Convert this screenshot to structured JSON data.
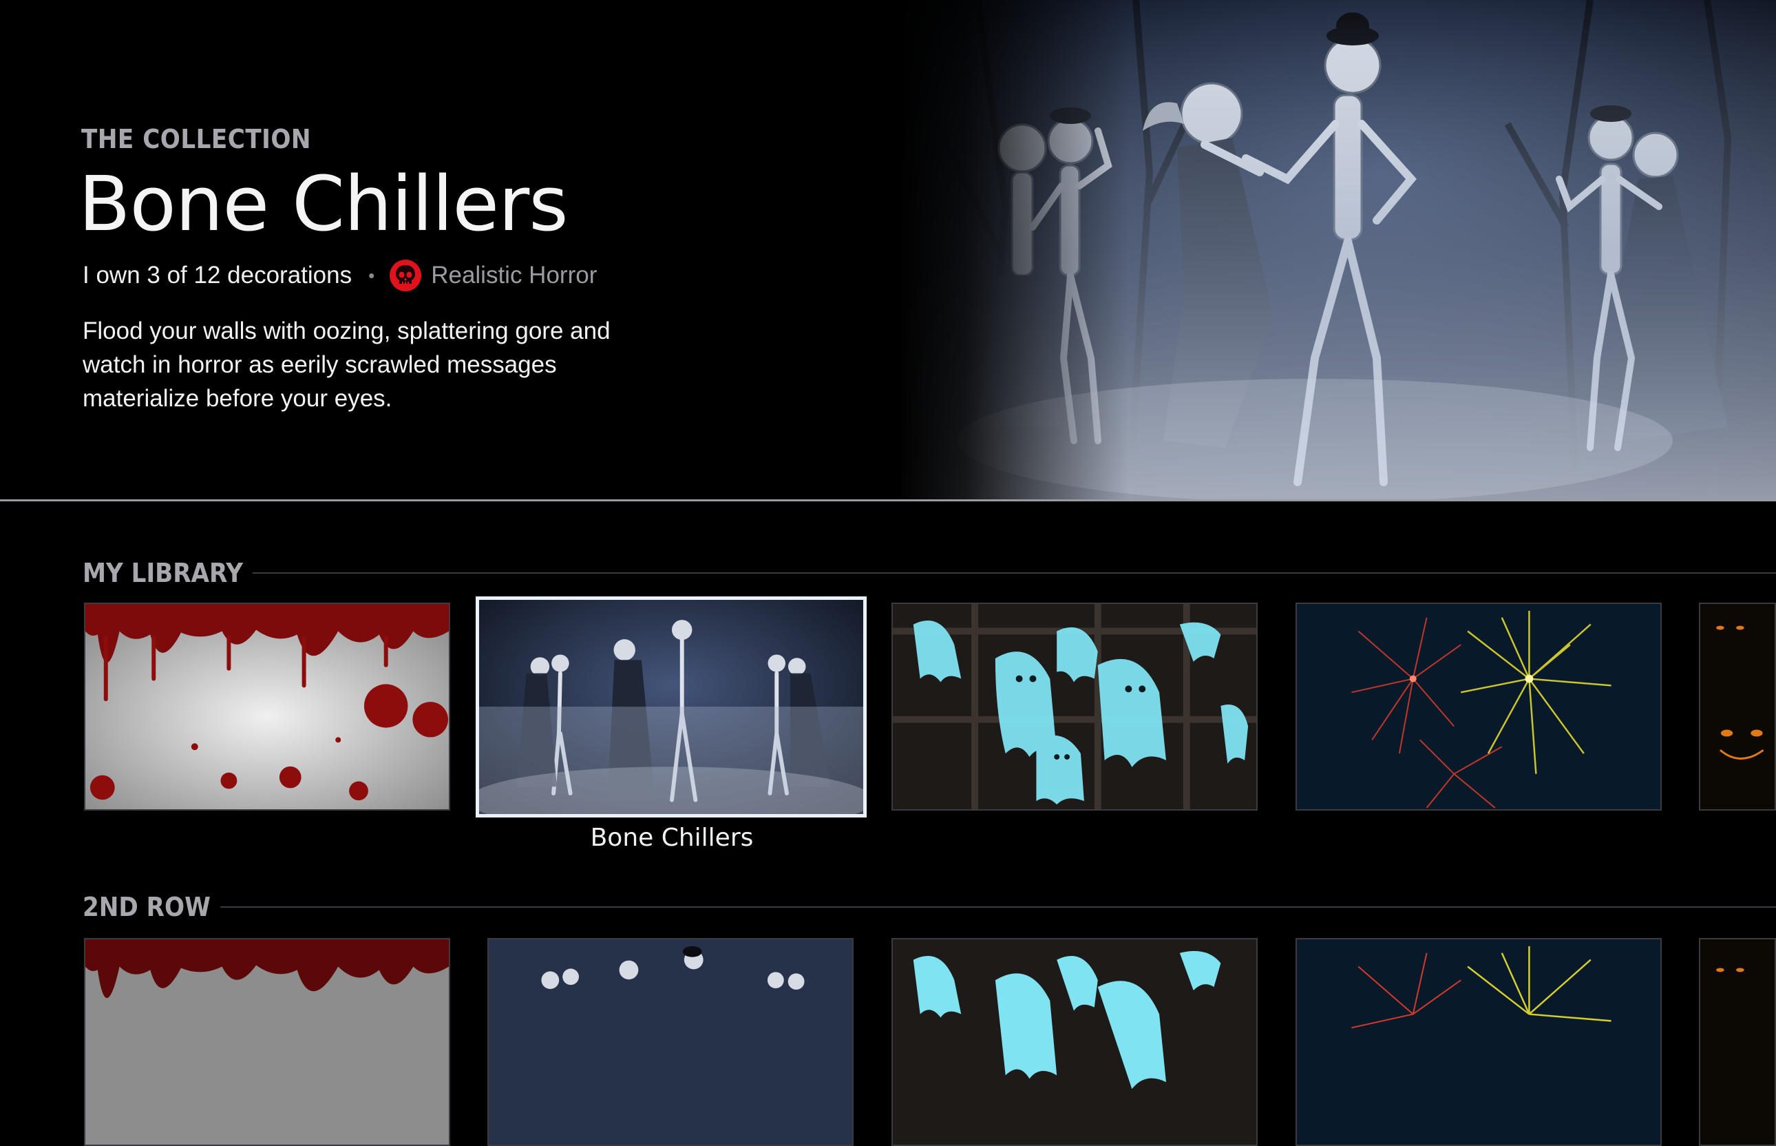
{
  "hero": {
    "eyebrow": "THE COLLECTION",
    "title": "Bone Chillers",
    "ownership": "I own 3 of 12 decorations",
    "separator": "•",
    "genre_icon": "red-skull-icon",
    "genre": "Realistic Horror",
    "description": "Flood your walls with oozing, splattering gore and watch in horror as eerily scrawled messages materialize before your eyes.",
    "art": "dancing-skeletons-in-fog"
  },
  "rows": [
    {
      "title": "MY LIBRARY",
      "tiles": [
        {
          "art": "blood-splatter-wall",
          "label": ""
        },
        {
          "art": "dancing-skeletons",
          "label": "Bone Chillers",
          "focused": true
        },
        {
          "art": "flying-ghosts",
          "label": ""
        },
        {
          "art": "fireworks",
          "label": ""
        },
        {
          "art": "glowing-eyes",
          "label": ""
        }
      ]
    },
    {
      "title": "2ND ROW",
      "tiles": [
        {
          "art": "blood-splatter-wall",
          "label": ""
        },
        {
          "art": "dancing-skeletons",
          "label": ""
        },
        {
          "art": "flying-ghosts",
          "label": ""
        },
        {
          "art": "fireworks",
          "label": ""
        },
        {
          "art": "glowing-eyes",
          "label": ""
        }
      ]
    }
  ],
  "colors": {
    "background": "#000000",
    "eyebrow": "#a7a7ad",
    "focus_border": "#eaf2f8",
    "skull": "#e0121b",
    "divider": "#9a9aa0"
  }
}
